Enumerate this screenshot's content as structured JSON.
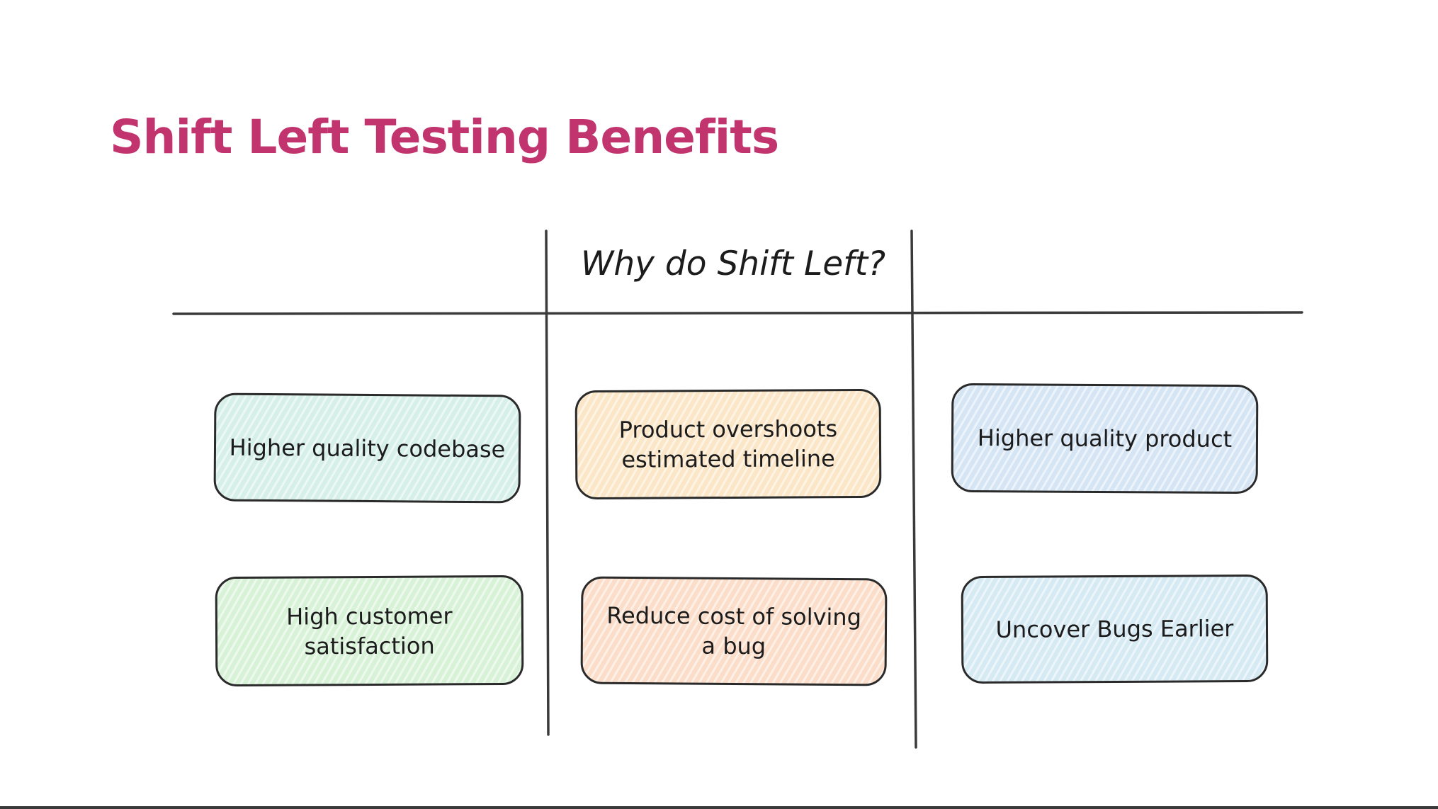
{
  "slide": {
    "title": "Shift Left Testing Benefits",
    "title_color": "#c2346e"
  },
  "diagram": {
    "heading": "Why do Shift Left?",
    "boxes": [
      {
        "label": "Higher quality codebase",
        "fill": "#d6f0e9"
      },
      {
        "label": "Product overshoots\nestimated timeline",
        "fill": "#fbe6c8"
      },
      {
        "label": "Higher quality product",
        "fill": "#d5e5f4"
      },
      {
        "label": "High customer\nsatisfaction",
        "fill": "#d8f2d8"
      },
      {
        "label": "Reduce cost of solving\na bug",
        "fill": "#fbddc9"
      },
      {
        "label": "Uncover Bugs Earlier",
        "fill": "#d6eaf4"
      }
    ]
  }
}
